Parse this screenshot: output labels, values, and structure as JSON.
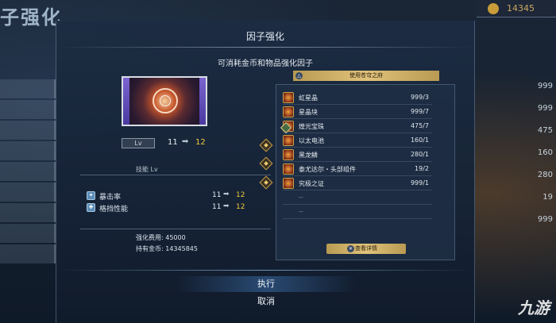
{
  "background": {
    "screen_title": "子强化",
    "gold_display": "14345",
    "right_values": [
      "999",
      "999",
      "475",
      "160",
      "280",
      "19",
      "999"
    ],
    "watermark": "九游"
  },
  "dialog": {
    "title": "因子强化",
    "subtitle": "可消耗金币和物品强化因子",
    "level": {
      "label": "Lv",
      "from": "11",
      "arrow": "➡",
      "to": "12"
    },
    "skill_lv_label": "技能 Lv",
    "stats": [
      {
        "name": "暴击率",
        "from": "11",
        "arrow": "➡",
        "to": "12"
      },
      {
        "name": "格挡性能",
        "from": "11",
        "arrow": "➡",
        "to": "12"
      }
    ],
    "cost": {
      "fee_label": "强化费用:",
      "fee_value": "45000",
      "gold_label": "持有金币:",
      "gold_value": "14345845"
    },
    "materials": {
      "header": "使用苍穹之府",
      "items": [
        {
          "name": "虹星晶",
          "qty": "999/3"
        },
        {
          "name": "星晶块",
          "qty": "999/7"
        },
        {
          "name": "煌光宝珠",
          "qty": "475/7"
        },
        {
          "name": "以太电池",
          "qty": "160/1"
        },
        {
          "name": "黑龙鳞",
          "qty": "280/1"
        },
        {
          "name": "泰尤达尔・头部组件",
          "qty": "19/2"
        },
        {
          "name": "究极之证",
          "qty": "999/1"
        }
      ],
      "empty_rows": [
        "--",
        "--"
      ],
      "details_button": "查看详情"
    },
    "execute_label": "执行",
    "cancel_label": "取消"
  },
  "colors": {
    "accent_gold": "#f0c93a",
    "panel_bg": "#1c2c42",
    "button_gold": "#e0c27a"
  }
}
